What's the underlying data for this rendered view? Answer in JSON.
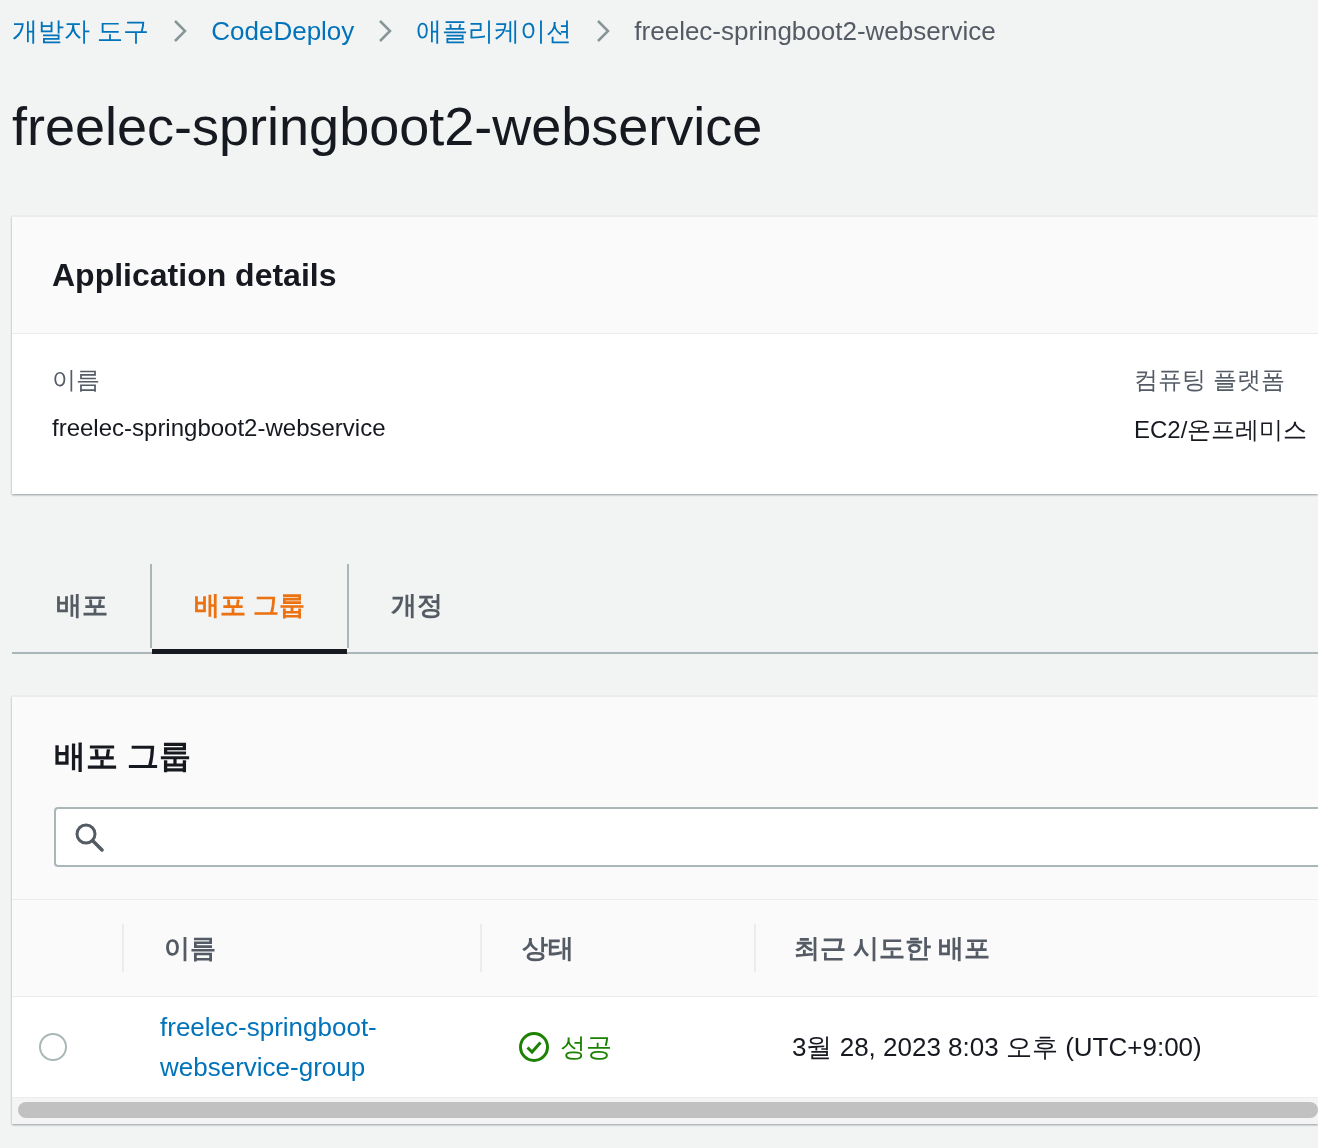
{
  "breadcrumbs": [
    {
      "label": "개발자 도구",
      "link": true
    },
    {
      "label": "CodeDeploy",
      "link": true
    },
    {
      "label": "애플리케이션",
      "link": true
    },
    {
      "label": "freelec-springboot2-webservice",
      "link": false
    }
  ],
  "title": "freelec-springboot2-webservice",
  "details": {
    "title": "Application details",
    "fields": [
      {
        "label": "이름",
        "value": "freelec-springboot2-webservice"
      },
      {
        "label": "컴퓨팅 플랫폼",
        "value": "EC2/온프레미스"
      }
    ]
  },
  "tabs": [
    {
      "label": "배포",
      "selected": false
    },
    {
      "label": "배포 그룹",
      "selected": true
    },
    {
      "label": "개정",
      "selected": false
    }
  ],
  "groups": {
    "title": "배포 그룹",
    "columns": [
      "이름",
      "상태",
      "최근 시도한 배포"
    ],
    "rows": [
      {
        "selected": false,
        "name": "freelec-springboot-webservice-group",
        "status": {
          "kind": "success",
          "text": "성공"
        },
        "last": "3월 28, 2023 8:03 오후 (UTC+9:00)"
      }
    ]
  }
}
